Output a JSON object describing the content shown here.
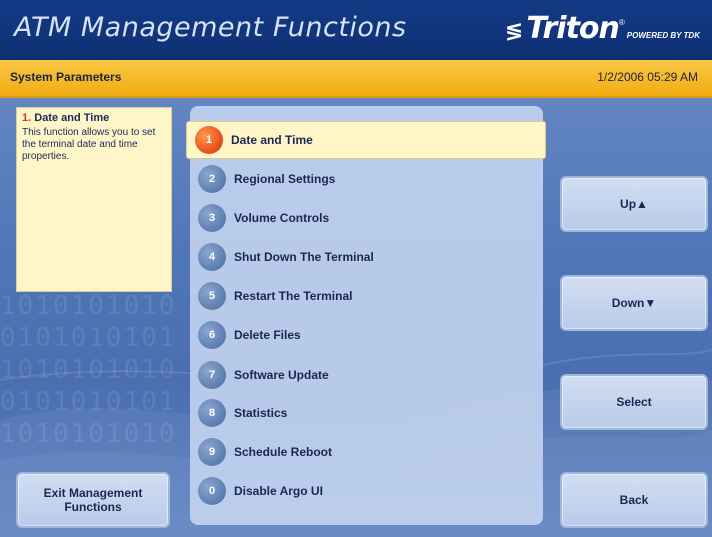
{
  "header": {
    "title": "ATM Management Functions",
    "logo_name": "Triton",
    "logo_reg": "®",
    "logo_powered": "POWERED BY TDK"
  },
  "statusbar": {
    "section": "System Parameters",
    "datetime": "1/2/2006  05:29 AM"
  },
  "info": {
    "number": "1.",
    "title": "Date and Time",
    "body": "This function allows you to set the terminal date and time properties."
  },
  "menu": {
    "selected_index": 0,
    "items": [
      {
        "num": "1",
        "label": "Date and Time"
      },
      {
        "num": "2",
        "label": "Regional Settings"
      },
      {
        "num": "3",
        "label": "Volume Controls"
      },
      {
        "num": "4",
        "label": "Shut Down The Terminal"
      },
      {
        "num": "5",
        "label": "Restart The Terminal"
      },
      {
        "num": "6",
        "label": "Delete Files"
      },
      {
        "num": "7",
        "label": "Software Update"
      },
      {
        "num": "8",
        "label": "Statistics"
      },
      {
        "num": "9",
        "label": "Schedule Reboot"
      },
      {
        "num": "0",
        "label": "Disable Argo UI"
      }
    ]
  },
  "buttons": {
    "up": "Up",
    "down": "Down",
    "select": "Select",
    "back": "Back",
    "exit": "Exit Management Functions"
  },
  "icons": {
    "up_arrow": "up-triangle",
    "down_arrow": "down-triangle"
  },
  "colors": {
    "header_bg": "#0f2f73",
    "status_bg": "#f2ad12",
    "selected_badge": "#e8501a",
    "info_bg": "#fef6c8"
  }
}
